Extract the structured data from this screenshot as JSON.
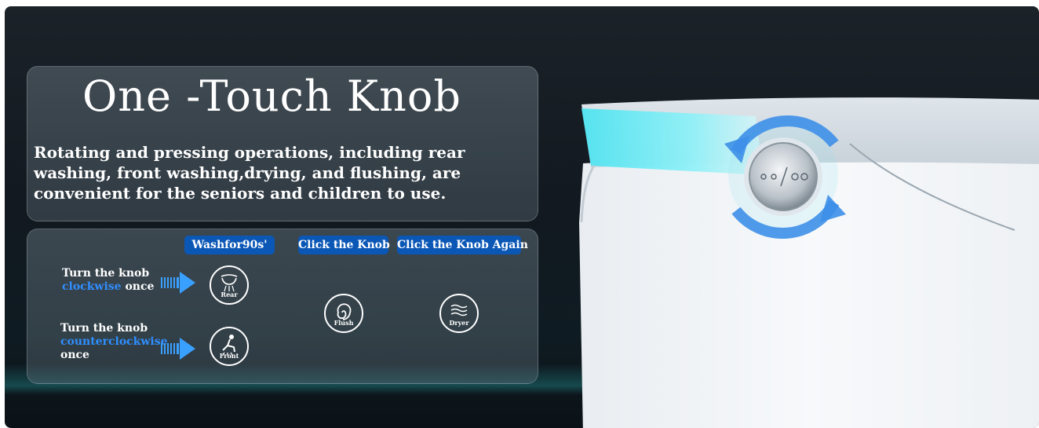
{
  "title": "One -Touch Knob",
  "description": "Rotating and pressing operations, including rear washing, front washing,drying, and flushing, are convenient for the seniors and children to use.",
  "pills": {
    "wash": "Washfor90s'",
    "click": "Click the Knob",
    "click_again": "Click the Knob Again"
  },
  "instructions": {
    "clockwise": {
      "line1": "Turn the knob",
      "direction": "clockwise",
      "suffix": "once"
    },
    "counterclockwise": {
      "line1": "Turn the knob",
      "direction": "counterclockwise",
      "suffix": "once"
    }
  },
  "icons": {
    "rear": {
      "label": "Rear",
      "icon": "rear-wash-icon"
    },
    "front": {
      "label": "Front",
      "icon": "front-wash-icon"
    },
    "flush": {
      "label": "Flush",
      "icon": "flush-icon"
    },
    "dryer": {
      "label": "Dryer",
      "icon": "dryer-icon"
    }
  },
  "colors": {
    "accent_blue": "#0b57b6",
    "highlight_blue": "#2f8fff",
    "arrow_blue": "#3aa0ff",
    "glow_cyan": "#4fe3f0"
  }
}
